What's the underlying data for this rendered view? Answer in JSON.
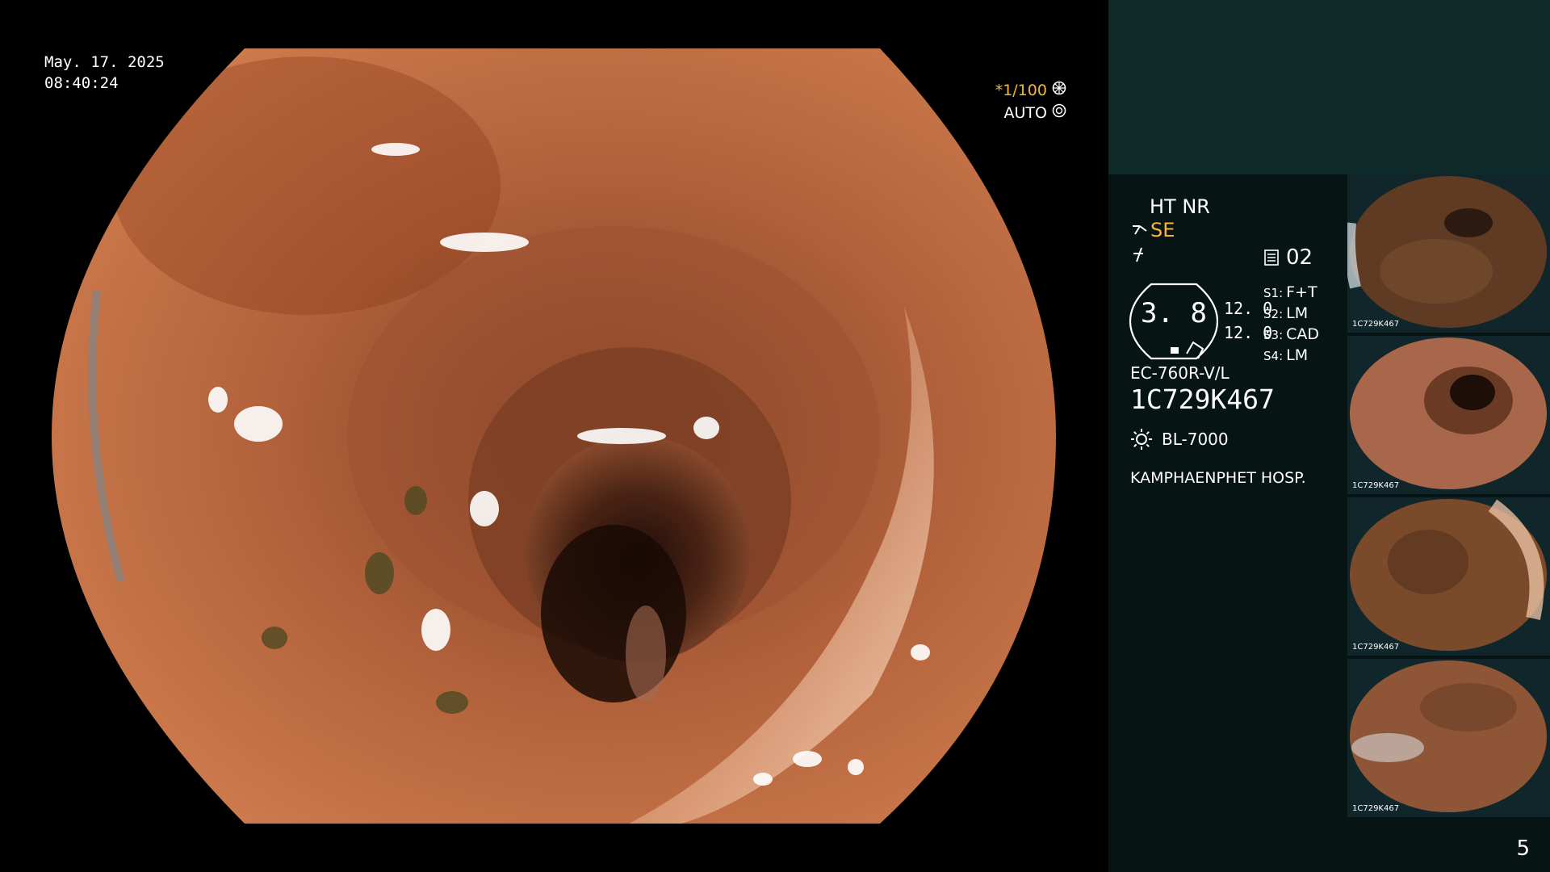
{
  "overlay": {
    "date": "May. 17. 2025",
    "time": "08:40:24",
    "shutter_speed": "*1/100",
    "exposure_mode": "AUTO"
  },
  "processor_info": {
    "mode_line": "HT NR",
    "enhance_mode": "SE",
    "capture_count": "02",
    "gauge_value": "3. 8",
    "gauge_side_values": [
      "12. 0",
      "12. 0"
    ],
    "switches": [
      {
        "key": "S1:",
        "value": "F+T"
      },
      {
        "key": "S2:",
        "value": "LM"
      },
      {
        "key": "S3:",
        "value": "CAD"
      },
      {
        "key": "S4:",
        "value": "LM"
      }
    ],
    "scope_model": "EC-760R-V/L",
    "scope_serial": "1C729K467",
    "light_source": "BL-7000",
    "hospital": "KAMPHAENPHET HOSP."
  },
  "thumbnails": [
    {
      "label": "1C729K467"
    },
    {
      "label": "1C729K467"
    },
    {
      "label": "1C729K467"
    },
    {
      "label": "1C729K467"
    }
  ],
  "page_number": "5",
  "colors": {
    "accent": "#f5b63a",
    "side_top": "#0e2b2a",
    "side_panel": "#061414"
  },
  "icons": [
    "light-mode-icon",
    "freeze-icon",
    "capture-icon",
    "lamp-icon",
    "shutter-dial-icon",
    "auto-dial-icon"
  ]
}
